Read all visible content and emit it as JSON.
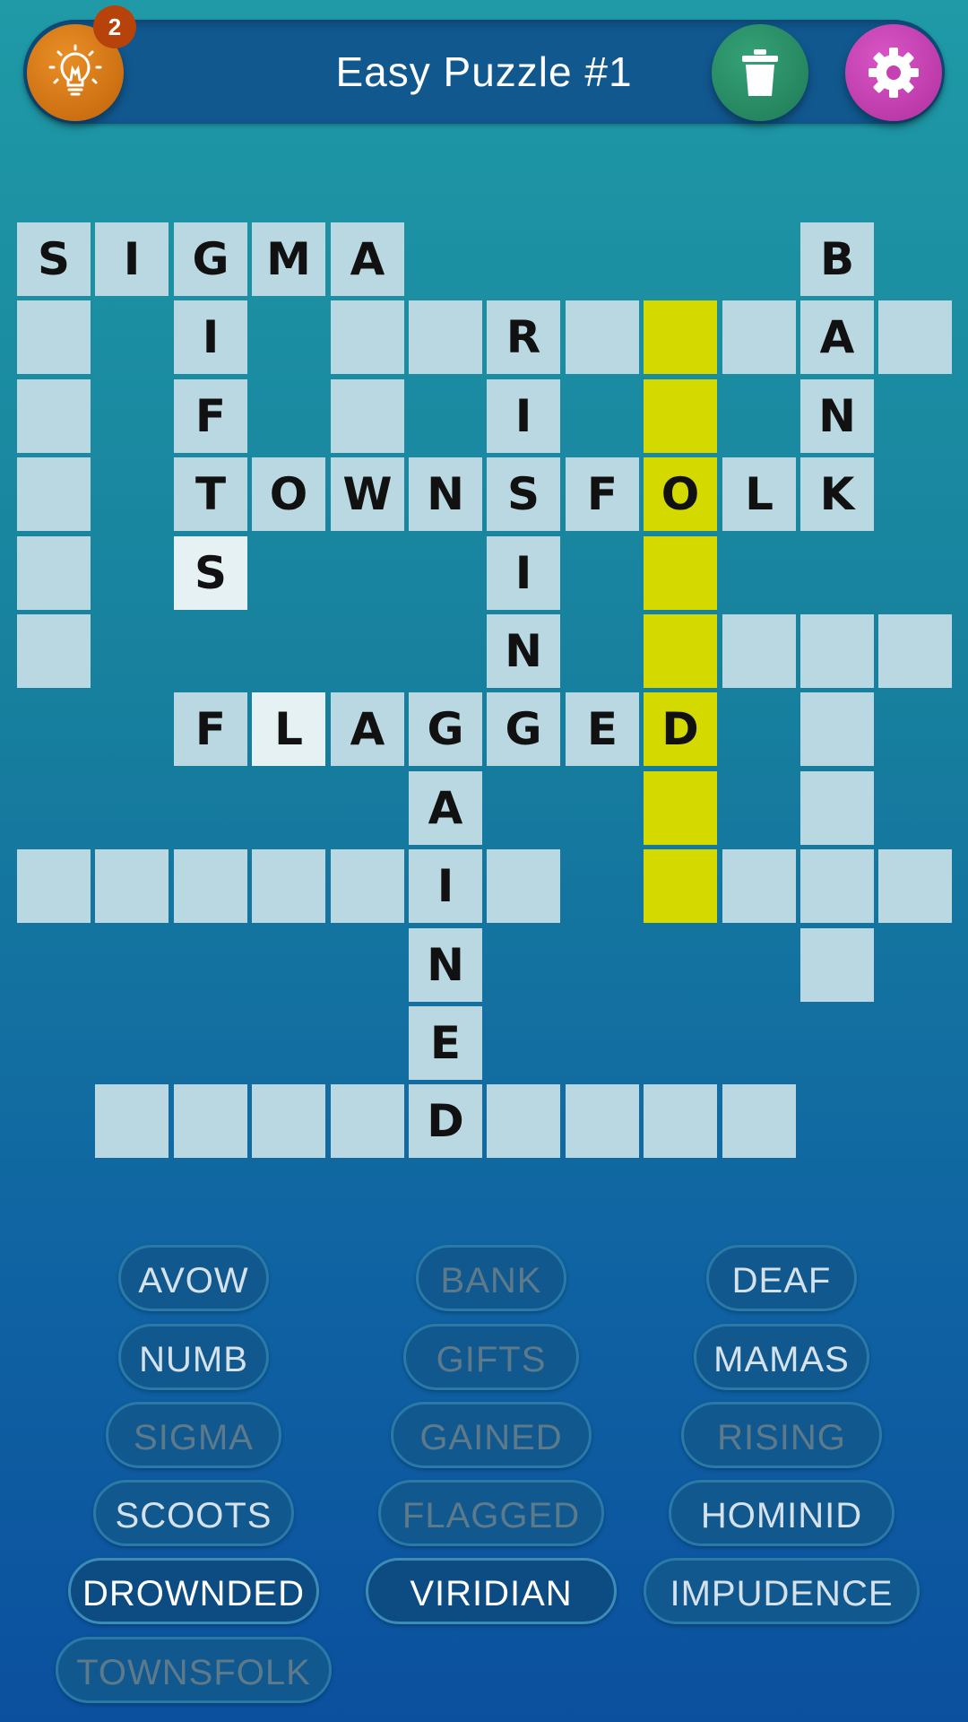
{
  "header": {
    "title": "Easy Puzzle #1",
    "hint_count": "2",
    "hint_icon": "lightbulb-icon",
    "trash_icon": "trash-icon",
    "settings_icon": "gear-icon"
  },
  "colors": {
    "cell": "#b9d8e1",
    "highlight": "#d4d900",
    "hint_button": "#d37a18",
    "trash_button": "#2b8e66",
    "settings_button": "#c541b1"
  },
  "grid": {
    "cells": [
      {
        "r": 0,
        "c": 0,
        "letter": "S"
      },
      {
        "r": 0,
        "c": 1,
        "letter": "I"
      },
      {
        "r": 0,
        "c": 2,
        "letter": "G"
      },
      {
        "r": 0,
        "c": 3,
        "letter": "M"
      },
      {
        "r": 0,
        "c": 4,
        "letter": "A"
      },
      {
        "r": 0,
        "c": 10,
        "letter": "B"
      },
      {
        "r": 1,
        "c": 0,
        "letter": ""
      },
      {
        "r": 1,
        "c": 2,
        "letter": "I"
      },
      {
        "r": 1,
        "c": 4,
        "letter": ""
      },
      {
        "r": 1,
        "c": 5,
        "letter": ""
      },
      {
        "r": 1,
        "c": 6,
        "letter": "R"
      },
      {
        "r": 1,
        "c": 7,
        "letter": ""
      },
      {
        "r": 1,
        "c": 8,
        "letter": "",
        "state": "highlight"
      },
      {
        "r": 1,
        "c": 9,
        "letter": ""
      },
      {
        "r": 1,
        "c": 10,
        "letter": "A"
      },
      {
        "r": 1,
        "c": 11,
        "letter": ""
      },
      {
        "r": 2,
        "c": 0,
        "letter": ""
      },
      {
        "r": 2,
        "c": 2,
        "letter": "F"
      },
      {
        "r": 2,
        "c": 4,
        "letter": ""
      },
      {
        "r": 2,
        "c": 6,
        "letter": "I"
      },
      {
        "r": 2,
        "c": 8,
        "letter": "",
        "state": "highlight"
      },
      {
        "r": 2,
        "c": 10,
        "letter": "N"
      },
      {
        "r": 3,
        "c": 0,
        "letter": ""
      },
      {
        "r": 3,
        "c": 2,
        "letter": "T"
      },
      {
        "r": 3,
        "c": 3,
        "letter": "O"
      },
      {
        "r": 3,
        "c": 4,
        "letter": "W"
      },
      {
        "r": 3,
        "c": 5,
        "letter": "N"
      },
      {
        "r": 3,
        "c": 6,
        "letter": "S"
      },
      {
        "r": 3,
        "c": 7,
        "letter": "F"
      },
      {
        "r": 3,
        "c": 8,
        "letter": "O",
        "state": "highlight"
      },
      {
        "r": 3,
        "c": 9,
        "letter": "L"
      },
      {
        "r": 3,
        "c": 10,
        "letter": "K"
      },
      {
        "r": 4,
        "c": 0,
        "letter": ""
      },
      {
        "r": 4,
        "c": 2,
        "letter": "S",
        "state": "light"
      },
      {
        "r": 4,
        "c": 6,
        "letter": "I"
      },
      {
        "r": 4,
        "c": 8,
        "letter": "",
        "state": "highlight"
      },
      {
        "r": 5,
        "c": 0,
        "letter": ""
      },
      {
        "r": 5,
        "c": 6,
        "letter": "N"
      },
      {
        "r": 5,
        "c": 8,
        "letter": "",
        "state": "highlight"
      },
      {
        "r": 5,
        "c": 9,
        "letter": ""
      },
      {
        "r": 5,
        "c": 10,
        "letter": ""
      },
      {
        "r": 5,
        "c": 11,
        "letter": ""
      },
      {
        "r": 6,
        "c": 2,
        "letter": "F"
      },
      {
        "r": 6,
        "c": 3,
        "letter": "L",
        "state": "light"
      },
      {
        "r": 6,
        "c": 4,
        "letter": "A"
      },
      {
        "r": 6,
        "c": 5,
        "letter": "G"
      },
      {
        "r": 6,
        "c": 6,
        "letter": "G"
      },
      {
        "r": 6,
        "c": 7,
        "letter": "E"
      },
      {
        "r": 6,
        "c": 8,
        "letter": "D",
        "state": "highlight"
      },
      {
        "r": 6,
        "c": 10,
        "letter": ""
      },
      {
        "r": 7,
        "c": 5,
        "letter": "A"
      },
      {
        "r": 7,
        "c": 8,
        "letter": "",
        "state": "highlight"
      },
      {
        "r": 7,
        "c": 10,
        "letter": ""
      },
      {
        "r": 8,
        "c": 0,
        "letter": ""
      },
      {
        "r": 8,
        "c": 1,
        "letter": ""
      },
      {
        "r": 8,
        "c": 2,
        "letter": ""
      },
      {
        "r": 8,
        "c": 3,
        "letter": ""
      },
      {
        "r": 8,
        "c": 4,
        "letter": ""
      },
      {
        "r": 8,
        "c": 5,
        "letter": "I"
      },
      {
        "r": 8,
        "c": 6,
        "letter": ""
      },
      {
        "r": 8,
        "c": 8,
        "letter": "",
        "state": "highlight"
      },
      {
        "r": 8,
        "c": 9,
        "letter": ""
      },
      {
        "r": 8,
        "c": 10,
        "letter": ""
      },
      {
        "r": 8,
        "c": 11,
        "letter": ""
      },
      {
        "r": 9,
        "c": 5,
        "letter": "N"
      },
      {
        "r": 9,
        "c": 10,
        "letter": ""
      },
      {
        "r": 10,
        "c": 5,
        "letter": "E"
      },
      {
        "r": 11,
        "c": 1,
        "letter": ""
      },
      {
        "r": 11,
        "c": 2,
        "letter": ""
      },
      {
        "r": 11,
        "c": 3,
        "letter": ""
      },
      {
        "r": 11,
        "c": 4,
        "letter": ""
      },
      {
        "r": 11,
        "c": 5,
        "letter": "D"
      },
      {
        "r": 11,
        "c": 6,
        "letter": ""
      },
      {
        "r": 11,
        "c": 7,
        "letter": ""
      },
      {
        "r": 11,
        "c": 8,
        "letter": ""
      },
      {
        "r": 11,
        "c": 9,
        "letter": ""
      }
    ]
  },
  "word_bank": [
    {
      "word": "AVOW",
      "status": "available"
    },
    {
      "word": "BANK",
      "status": "used"
    },
    {
      "word": "DEAF",
      "status": "available"
    },
    {
      "word": "NUMB",
      "status": "available"
    },
    {
      "word": "GIFTS",
      "status": "used"
    },
    {
      "word": "MAMAS",
      "status": "available"
    },
    {
      "word": "SIGMA",
      "status": "used"
    },
    {
      "word": "GAINED",
      "status": "used"
    },
    {
      "word": "RISING",
      "status": "used"
    },
    {
      "word": "SCOOTS",
      "status": "available"
    },
    {
      "word": "FLAGGED",
      "status": "used"
    },
    {
      "word": "HOMINID",
      "status": "available"
    },
    {
      "word": "DROWNDED",
      "status": "active"
    },
    {
      "word": "VIRIDIAN",
      "status": "active"
    },
    {
      "word": "IMPUDENCE",
      "status": "available"
    },
    {
      "word": "TOWNSFOLK",
      "status": "used"
    }
  ]
}
